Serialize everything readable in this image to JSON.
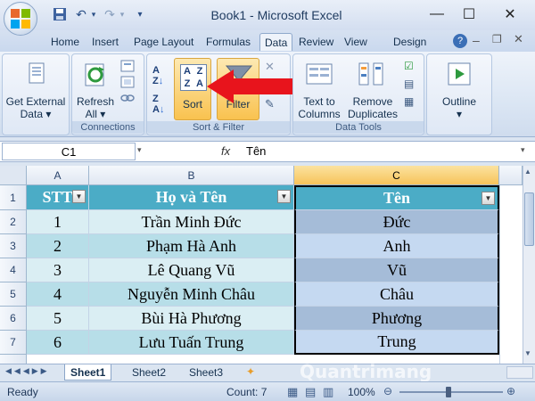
{
  "window": {
    "title": "Book1 - Microsoft Excel",
    "controls": [
      "minimize-icon",
      "maximize-icon",
      "close-icon"
    ]
  },
  "quick_access": [
    "save-icon",
    "undo-icon",
    "redo-icon",
    "customize-icon"
  ],
  "tabs": [
    {
      "label": "Home"
    },
    {
      "label": "Insert"
    },
    {
      "label": "Page Layout"
    },
    {
      "label": "Formulas"
    },
    {
      "label": "Data",
      "active": true
    },
    {
      "label": "Review"
    },
    {
      "label": "View"
    },
    {
      "label": "Design"
    }
  ],
  "ribbon": {
    "get_external": {
      "line1": "Get External",
      "line2": "Data ▾"
    },
    "refresh": {
      "line1": "Refresh",
      "line2": "All ▾"
    },
    "connections_label": "Connections",
    "sort_label": "Sort",
    "filter_label": "Filter",
    "sort_filter_label": "Sort & Filter",
    "text_to_columns": {
      "line1": "Text to",
      "line2": "Columns"
    },
    "remove_duplicates": {
      "line1": "Remove",
      "line2": "Duplicates"
    },
    "data_tools_label": "Data Tools",
    "outline": {
      "line1": "Outline",
      "line2": "▾"
    },
    "accent_arrow_color": "#e8141c"
  },
  "formula_bar": {
    "cell_ref": "C1",
    "fx": "fx",
    "content": "Tên"
  },
  "grid": {
    "columns": [
      "A",
      "B",
      "C"
    ],
    "selected_column": "C",
    "rows": [
      "1",
      "2",
      "3",
      "4",
      "5",
      "6",
      "7"
    ],
    "header": [
      "STT",
      "Họ và Tên",
      "Tên"
    ],
    "data": [
      [
        "1",
        "Trần Minh Đức",
        "Đức"
      ],
      [
        "2",
        "Phạm Hà Anh",
        "Anh"
      ],
      [
        "3",
        "Lê Quang Vũ",
        "Vũ"
      ],
      [
        "4",
        "Nguyễn Minh Châu",
        "Châu"
      ],
      [
        "5",
        "Bùi Hà Phương",
        "Phương"
      ],
      [
        "6",
        "Lưu Tuấn Trung",
        "Trung"
      ]
    ],
    "colors": {
      "header": "#4bacc6",
      "band_light": "#daeef3",
      "band_dark": "#b7dee8",
      "sel_light": "#c5d9f1",
      "sel_dark": "#a5bcd8"
    }
  },
  "sheets": [
    {
      "label": "Sheet1",
      "active": true
    },
    {
      "label": "Sheet2"
    },
    {
      "label": "Sheet3"
    }
  ],
  "status": {
    "ready": "Ready",
    "count": "Count: 7",
    "zoom": "100%"
  },
  "watermark": "Quantrimang"
}
